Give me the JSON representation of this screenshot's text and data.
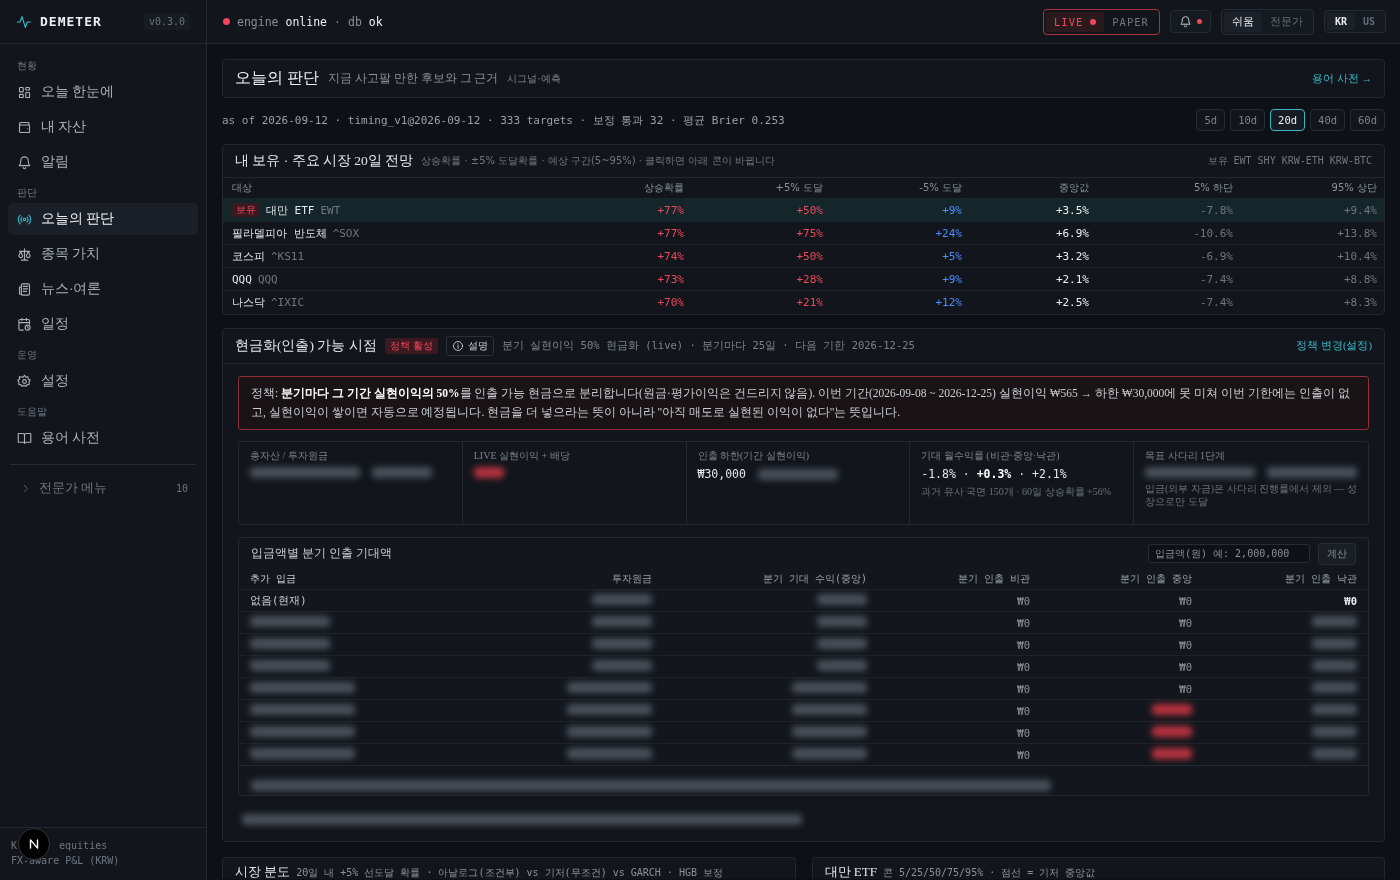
{
  "sidebar": {
    "logo": "DEMETER",
    "version": "v0.3.0",
    "sections": [
      {
        "heading": "현황",
        "items": [
          {
            "label": "오늘 한눈에",
            "kind": "grid",
            "selected": false
          },
          {
            "label": "내 자산",
            "kind": "wallet",
            "selected": false
          },
          {
            "label": "알림",
            "kind": "bell",
            "selected": false
          }
        ]
      },
      {
        "heading": "판단",
        "items": [
          {
            "label": "오늘의 판단",
            "kind": "broadcast",
            "selected": true
          },
          {
            "label": "종목 가치",
            "kind": "scale",
            "selected": false
          },
          {
            "label": "뉴스·여론",
            "kind": "news",
            "selected": false
          },
          {
            "label": "일정",
            "kind": "calendar",
            "selected": false
          }
        ]
      },
      {
        "heading": "운영",
        "items": [
          {
            "label": "설정",
            "kind": "gear",
            "selected": false
          }
        ]
      },
      {
        "heading": "도움말",
        "items": [
          {
            "label": "용어 사전",
            "kind": "book",
            "selected": false
          }
        ]
      }
    ],
    "expert_menu": {
      "label": "전문가 메뉴",
      "count": "10",
      "expanded": false
    },
    "footer": {
      "line_1_start": "K",
      "line_1_end": "equities",
      "line_2": "FX-aware P&L (KRW)"
    }
  },
  "status": {
    "engine_label": "engine",
    "engine_state": "online",
    "separator": "·",
    "db_label": "db",
    "db_state": "ok"
  },
  "mode_toggle": [
    {
      "label": "LIVE",
      "selected": true
    },
    {
      "label": "PAPER",
      "selected": false
    }
  ],
  "notifications": {
    "unread": true
  },
  "level_toggle": [
    {
      "label": "쉬움",
      "selected": true
    },
    {
      "label": "전문가",
      "selected": false
    }
  ],
  "market_toggle": [
    {
      "label": "KR",
      "selected": true
    },
    {
      "label": "US",
      "selected": false
    }
  ],
  "header": {
    "title": "오늘의 판단",
    "subtitle": "지금 사고팔 만한 후보와 그 근거",
    "tag": "시그널·예측",
    "link": "용어 사전 →"
  },
  "meta": "as of 2026-09-12 · timing_v1@2026-09-12 · 333 targets · 보정 통과 32 · 평균 Brier 0.253",
  "horizons": [
    {
      "label": "5d",
      "selected": false
    },
    {
      "label": "10d",
      "selected": false
    },
    {
      "label": "20d",
      "selected": true
    },
    {
      "label": "40d",
      "selected": false
    },
    {
      "label": "60d",
      "selected": false
    }
  ],
  "forecast": {
    "title": "내 보유 · 주요 시장 20일 전망",
    "notes": "상승확률 · ±5% 도달확률 · 예상 구간(5~95%) · 클릭하면 아래 콘이 바뀝니다",
    "holdings": "보유 EWT SHY KRW-ETH KRW-BTC",
    "columns": [
      "대상",
      "상승확률",
      "+5% 도달",
      "-5% 도달",
      "중앙값",
      "5% 하단",
      "95% 상단"
    ],
    "rows": [
      {
        "badge": "보유",
        "name": "대만 ETF",
        "ticker": "EWT",
        "selected": true,
        "values": [
          "+77%",
          "+50%",
          "+9%",
          "+3.5%",
          "-7.8%",
          "+9.4%"
        ]
      },
      {
        "name": "필라델피아 반도체",
        "ticker": "^SOX",
        "selected": false,
        "values": [
          "+77%",
          "+75%",
          "+24%",
          "+6.9%",
          "-10.6%",
          "+13.8%"
        ]
      },
      {
        "name": "코스피",
        "ticker": "^KS11",
        "selected": false,
        "values": [
          "+74%",
          "+50%",
          "+5%",
          "+3.2%",
          "-6.9%",
          "+10.4%"
        ]
      },
      {
        "name": "QQQ",
        "ticker": "QQQ",
        "selected": false,
        "values": [
          "+73%",
          "+28%",
          "+9%",
          "+2.1%",
          "-7.4%",
          "+8.8%"
        ]
      },
      {
        "name": "나스닥",
        "ticker": "^IXIC",
        "selected": false,
        "values": [
          "+70%",
          "+21%",
          "+12%",
          "+2.5%",
          "-7.4%",
          "+8.3%"
        ]
      }
    ]
  },
  "cash": {
    "title": "현금화(인출) 가능 시점",
    "badge": "정책 활성",
    "explain": "설명",
    "summary": "분기 실현이익 50% 현금화 (live) · 분기마다 25일 · 다음 기한 2026-12-25",
    "link": "정책 변경(설정)",
    "notice": "정책: **분기마다 그 기간 실현이익의 50%**를 인출 가능 현금으로 분리합니다(원금·평가이익은 건드리지 않음). 이번 기간(2026-09-08 ~ 2026-12-25) 실현이익 ₩565 → 하한 ₩30,000에 못 미쳐 이번 기한에는 인출이 없고, 실현이익이 쌓이면 자동으로 예정됩니다. 현금을 더 넣으라는 뜻이 아니라 \"아직 매도로 실현된 이익이 없다\"는 뜻입니다.",
    "stats": [
      {
        "label": "총자산 / 투자원금",
        "value": {
          "kind": "blurred"
        }
      },
      {
        "label": "LIVE 실현이익 + 배당",
        "value": {
          "kind": "blurred",
          "color": "#b8323f"
        }
      },
      {
        "label": "인출 하한(기간 실현이익)",
        "value": {
          "kind": "text",
          "text": "₩30,000"
        }
      },
      {
        "label": "기대 월수익률 (비관·중앙·낙관)",
        "value": {
          "kind": "text",
          "text": "-1.8% · **+0.3%** · +2.1%"
        },
        "note": "과거 유사 국면 150개 · 60일 상승확률 +56%"
      },
      {
        "label": "목표 사다리 1단계",
        "value": {
          "kind": "blurred"
        },
        "note": "입금(외부 자금)은 사다리 진행률에서 제외 — 성장으로만 도달"
      }
    ],
    "calculator": {
      "title": "입금액별 분기 인출 기대액",
      "placeholder": "입금액(원) 예: 2,000,000",
      "button": "계산",
      "columns": [
        "추가 입금",
        "투자원금",
        "분기 기대 수익(중앙)",
        "분기 인출 비관",
        "분기 인출 중앙",
        "분기 인출 낙관"
      ],
      "rows": [
        [
          {
            "kind": "text",
            "text": "없음(현재)"
          },
          {
            "kind": "blurred"
          },
          {
            "kind": "blurred"
          },
          {
            "kind": "text",
            "text": "₩0"
          },
          {
            "kind": "text",
            "text": "₩0"
          },
          {
            "kind": "text",
            "text": "₩0",
            "strong": true
          }
        ],
        [
          {
            "kind": "blurred"
          },
          {
            "kind": "blurred"
          },
          {
            "kind": "blurred"
          },
          {
            "kind": "text",
            "text": "₩0"
          },
          {
            "kind": "text",
            "text": "₩0"
          },
          {
            "kind": "blurred"
          }
        ],
        [
          {
            "kind": "blurred"
          },
          {
            "kind": "blurred"
          },
          {
            "kind": "blurred"
          },
          {
            "kind": "text",
            "text": "₩0"
          },
          {
            "kind": "text",
            "text": "₩0"
          },
          {
            "kind": "blurred"
          }
        ],
        [
          {
            "kind": "blurred"
          },
          {
            "kind": "blurred"
          },
          {
            "kind": "blurred"
          },
          {
            "kind": "text",
            "text": "₩0"
          },
          {
            "kind": "text",
            "text": "₩0"
          },
          {
            "kind": "blurred"
          }
        ],
        [
          {
            "kind": "blurred"
          },
          {
            "kind": "blurred"
          },
          {
            "kind": "blurred"
          },
          {
            "kind": "text",
            "text": "₩0"
          },
          {
            "kind": "text",
            "text": "₩0"
          },
          {
            "kind": "blurred"
          }
        ],
        [
          {
            "kind": "blurred"
          },
          {
            "kind": "blurred"
          },
          {
            "kind": "blurred"
          },
          {
            "kind": "text",
            "text": "₩0"
          },
          {
            "kind": "blurred",
            "color": "#b8323f"
          },
          {
            "kind": "blurred"
          }
        ],
        [
          {
            "kind": "blurred"
          },
          {
            "kind": "blurred"
          },
          {
            "kind": "blurred"
          },
          {
            "kind": "text",
            "text": "₩0"
          },
          {
            "kind": "blurred",
            "color": "#b8323f"
          },
          {
            "kind": "blurred"
          }
        ],
        [
          {
            "kind": "blurred"
          },
          {
            "kind": "blurred"
          },
          {
            "kind": "blurred"
          },
          {
            "kind": "text",
            "text": "₩0"
          },
          {
            "kind": "blurred",
            "color": "#b8323f"
          },
          {
            "kind": "blurred"
          }
        ]
      ],
      "footnote": {
        "kind": "blurred"
      }
    },
    "footnote": {
      "kind": "blurred"
    }
  },
  "bottom_cards": [
    {
      "title": "시장 분도",
      "subtitle": "20일 내 +5% 선도달 확률 · 아날로그(조건부) vs 기저(무조건) vs GARCH · HGB 보정"
    },
    {
      "title": "대만 ETF",
      "subtitle": "콘 5/25/50/75/95% · 점선 = 기저 중앙값"
    }
  ]
}
